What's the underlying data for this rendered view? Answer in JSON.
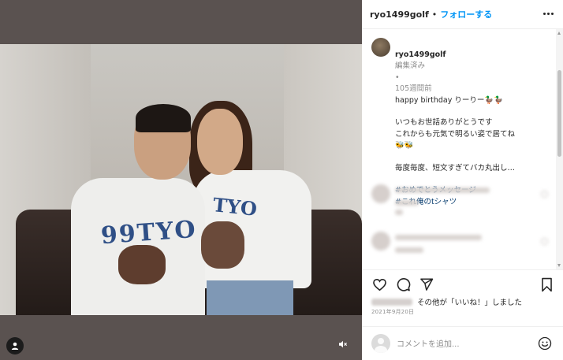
{
  "post": {
    "photo_shirt_text_1": "99TYO",
    "photo_shirt_text_2": "TYO"
  },
  "header": {
    "username": "ryo1499golf",
    "separator": "•",
    "follow_label": "フォローする"
  },
  "caption": {
    "username": "ryo1499golf",
    "edited": "編集済み",
    "separator": "•",
    "age": "105週間前",
    "lines": [
      "happy birthday りーりー🦆🦆",
      "",
      "いつもお世話ありがとうです",
      "これからも元気で明るい姿で居てね",
      "🐝🐝",
      "",
      "毎度毎度、短文すぎてバカ丸出し…"
    ],
    "hashtags": [
      "#おめでとうメッセージ",
      "#これ俺のtシャツ"
    ]
  },
  "actions": {
    "like_icon": "heart-icon",
    "comment_icon": "comment-icon",
    "share_icon": "paper-plane-icon",
    "save_icon": "bookmark-icon"
  },
  "likes": {
    "text": "その他が「いいね！」しました"
  },
  "date": "2021年9月20日",
  "comment": {
    "placeholder": "コメントを追加...",
    "emoji_icon": "smiley-icon"
  },
  "colors": {
    "accent": "#0095f6",
    "hashtag": "#00376b",
    "muted": "#8e8e8e"
  }
}
